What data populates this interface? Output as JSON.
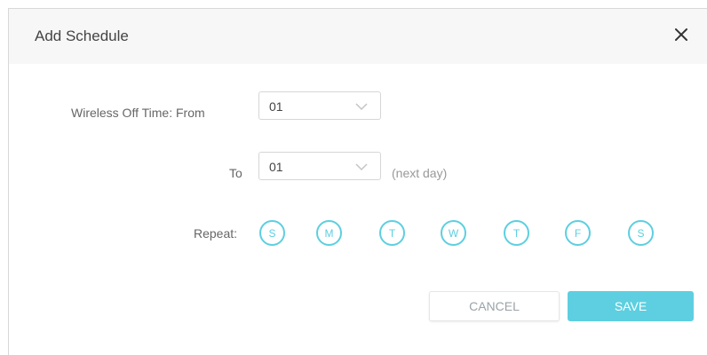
{
  "dialog": {
    "title": "Add Schedule",
    "close_icon": "close-icon"
  },
  "form": {
    "from_label": "Wireless Off Time:  From",
    "from_value": "01",
    "to_label": "To",
    "to_value": "01",
    "to_hint": "(next day)",
    "repeat_label": "Repeat:",
    "days": [
      "S",
      "M",
      "T",
      "W",
      "T",
      "F",
      "S"
    ]
  },
  "actions": {
    "cancel_label": "CANCEL",
    "save_label": "SAVE"
  },
  "colors": {
    "accent": "#5dcfe0",
    "header_bg": "#f7f7f7"
  }
}
